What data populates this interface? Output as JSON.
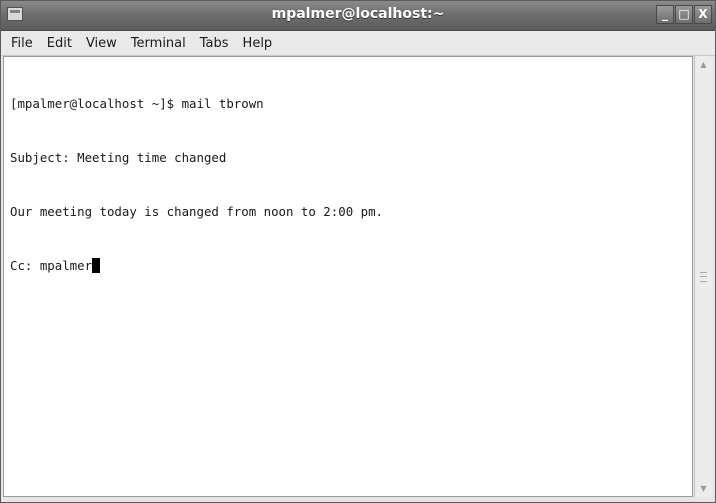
{
  "window": {
    "title": "mpalmer@localhost:~",
    "controls": {
      "minimize": "_",
      "maximize": "□",
      "close": "X"
    }
  },
  "menubar": {
    "items": [
      {
        "label": "File"
      },
      {
        "label": "Edit"
      },
      {
        "label": "View"
      },
      {
        "label": "Terminal"
      },
      {
        "label": "Tabs"
      },
      {
        "label": "Help"
      }
    ]
  },
  "terminal": {
    "lines": [
      "[mpalmer@localhost ~]$ mail tbrown",
      "Subject: Meeting time changed",
      "Our meeting today is changed from noon to 2:00 pm.",
      "Cc: mpalmer"
    ]
  }
}
